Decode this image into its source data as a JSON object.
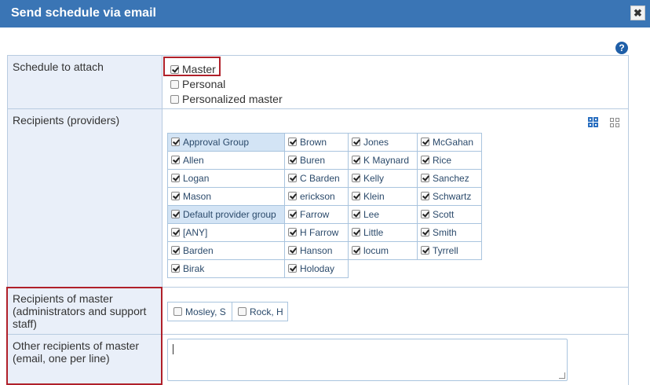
{
  "dialog": {
    "title": "Send schedule via email",
    "close_glyph": "✖",
    "help_glyph": "?"
  },
  "schedule": {
    "label": "Schedule to attach",
    "options": [
      {
        "label": "Master",
        "checked": true
      },
      {
        "label": "Personal",
        "checked": false
      },
      {
        "label": "Personalized master",
        "checked": false
      }
    ]
  },
  "providers": {
    "label": "Recipients (providers)",
    "view_icons": [
      "grid-view-icon",
      "compact-grid-view-icon"
    ],
    "rows": [
      [
        "Approval Group",
        "Brown",
        "Jones",
        "McGahan"
      ],
      [
        "Allen",
        "Buren",
        "K Maynard",
        "Rice"
      ],
      [
        "Logan",
        "C Barden",
        "Kelly",
        "Sanchez"
      ],
      [
        "Mason",
        "erickson",
        "Klein",
        "Schwartz"
      ],
      [
        "Default provider group",
        "Farrow",
        "Lee",
        "Scott"
      ],
      [
        "[ANY]",
        "H Farrow",
        "Little",
        "Smith"
      ],
      [
        "Barden",
        "Hanson",
        "locum",
        "Tyrrell"
      ],
      [
        "Birak",
        "Holoday",
        "",
        ""
      ]
    ],
    "all_checked": true
  },
  "support": {
    "label": "Recipients of master (administrators and support staff)",
    "items": [
      {
        "label": "Mosley, S",
        "checked": false
      },
      {
        "label": "Rock, H",
        "checked": false
      }
    ]
  },
  "other": {
    "label": "Other recipients of master (email, one per line)",
    "value": ""
  },
  "colors": {
    "title_bar": "#3a75b5",
    "label_bg": "#e9eff9",
    "highlight": "#d3e4f5",
    "annotation": "#b0202a"
  }
}
